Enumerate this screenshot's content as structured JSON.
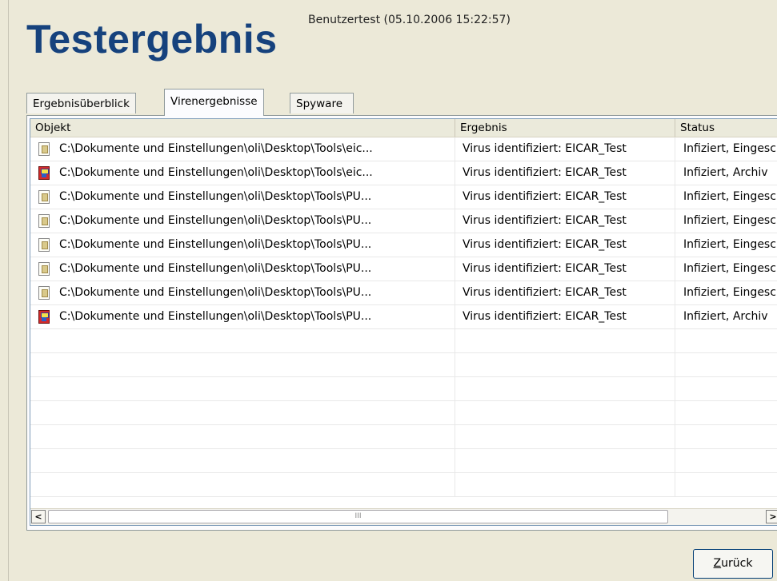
{
  "header": {
    "title": "Testergebnis",
    "subtitle": "Benutzertest (05.10.2006 15:22:57)"
  },
  "tabs": [
    {
      "label": "Ergebnisüberblick",
      "active": false
    },
    {
      "label": "Virenergebnisse",
      "active": true
    },
    {
      "label": "Spyware gefunden",
      "active": false
    }
  ],
  "table": {
    "columns": [
      "Objekt",
      "Ergebnis",
      "Status"
    ],
    "rows": [
      {
        "icon": "document-icon",
        "objekt": "C:\\Dokumente und Einstellungen\\oli\\Desktop\\Tools\\eic...",
        "ergebnis": "Virus identifiziert: EICAR_Test",
        "status": "Infiziert, Eingeschränkt"
      },
      {
        "icon": "archive-icon",
        "objekt": "C:\\Dokumente und Einstellungen\\oli\\Desktop\\Tools\\eic...",
        "ergebnis": "Virus identifiziert: EICAR_Test",
        "status": "Infiziert, Archiv"
      },
      {
        "icon": "document-icon",
        "objekt": "C:\\Dokumente und Einstellungen\\oli\\Desktop\\Tools\\PU...",
        "ergebnis": "Virus identifiziert: EICAR_Test",
        "status": "Infiziert, Eingeschränkt"
      },
      {
        "icon": "document-icon",
        "objekt": "C:\\Dokumente und Einstellungen\\oli\\Desktop\\Tools\\PU...",
        "ergebnis": "Virus identifiziert: EICAR_Test",
        "status": "Infiziert, Eingeschränkt"
      },
      {
        "icon": "document-icon",
        "objekt": "C:\\Dokumente und Einstellungen\\oli\\Desktop\\Tools\\PU...",
        "ergebnis": "Virus identifiziert: EICAR_Test",
        "status": "Infiziert, Eingeschränkt"
      },
      {
        "icon": "document-icon",
        "objekt": "C:\\Dokumente und Einstellungen\\oli\\Desktop\\Tools\\PU...",
        "ergebnis": "Virus identifiziert: EICAR_Test",
        "status": "Infiziert, Eingeschränkt"
      },
      {
        "icon": "document-icon",
        "objekt": "C:\\Dokumente und Einstellungen\\oli\\Desktop\\Tools\\PU...",
        "ergebnis": "Virus identifiziert: EICAR_Test",
        "status": "Infiziert, Eingeschränkt"
      },
      {
        "icon": "archive-icon",
        "objekt": "C:\\Dokumente und Einstellungen\\oli\\Desktop\\Tools\\PU...",
        "ergebnis": "Virus identifiziert: EICAR_Test",
        "status": "Infiziert, Archiv"
      }
    ]
  },
  "scrollbar": {
    "left_icon": "arrow-left-icon",
    "right_icon": "arrow-right-icon",
    "grip": "III"
  },
  "buttons": {
    "back_prefix": "Z",
    "back_rest": "urück"
  },
  "colors": {
    "title": "#16427d",
    "background": "#ece9d8",
    "list_border": "#7f9db9"
  }
}
